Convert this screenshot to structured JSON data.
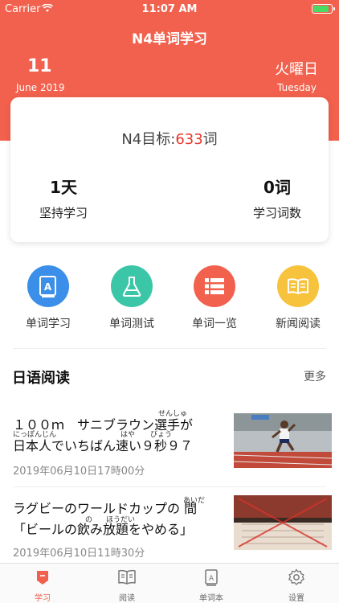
{
  "status_bar": {
    "carrier": "Carrier",
    "time": "11:07 AM",
    "battery_fraction": 0.9
  },
  "nav": {
    "title": "N4单词学习"
  },
  "date": {
    "day": "11",
    "month_year": "June 2019",
    "weekday_jp": "火曜日",
    "weekday_en": "Tuesday"
  },
  "summary": {
    "goal_prefix": "N4目标:",
    "goal_count": "633",
    "goal_suffix": "词",
    "days_value": "1天",
    "days_label": "坚持学习",
    "words_value": "0词",
    "words_label": "学习词数"
  },
  "quick_actions": [
    {
      "label": "单词学习",
      "icon": "book-a-icon",
      "color": "#3b8fe8"
    },
    {
      "label": "单词测试",
      "icon": "flask-icon",
      "color": "#3cc6a8"
    },
    {
      "label": "单词一览",
      "icon": "list-icon",
      "color": "#f2614d"
    },
    {
      "label": "新闻阅读",
      "icon": "open-book-icon",
      "color": "#f7c23c"
    }
  ],
  "reading": {
    "title": "日语阅读",
    "more": "更多",
    "articles": [
      {
        "line1": "１００ｍ　サニブラウン選手が",
        "line2": "日本人でいちばん速い９秒９７",
        "furi_senshu": "せんしゅ",
        "furi_nihonjin": "にっぽんじん",
        "furi_haya": "はや",
        "furi_byou": "びょう",
        "date": "2019年06月10日17時00分"
      },
      {
        "line1": "ラグビーのワールドカップの 間",
        "line2": "「ビールの飲み放題をやめる」",
        "furi_aida": "あいだ",
        "furi_no": "の",
        "furi_houdai": "ほうだい",
        "date": "2019年06月10日11時30分"
      }
    ]
  },
  "tabs": [
    {
      "label": "学习",
      "icon": "learn-icon",
      "active": true
    },
    {
      "label": "阅读",
      "icon": "reading-icon",
      "active": false
    },
    {
      "label": "单词本",
      "icon": "wordbook-icon",
      "active": false
    },
    {
      "label": "设置",
      "icon": "gear-icon",
      "active": false
    }
  ],
  "colors": {
    "accent": "#f2614d",
    "goal_number": "#e8382c"
  }
}
